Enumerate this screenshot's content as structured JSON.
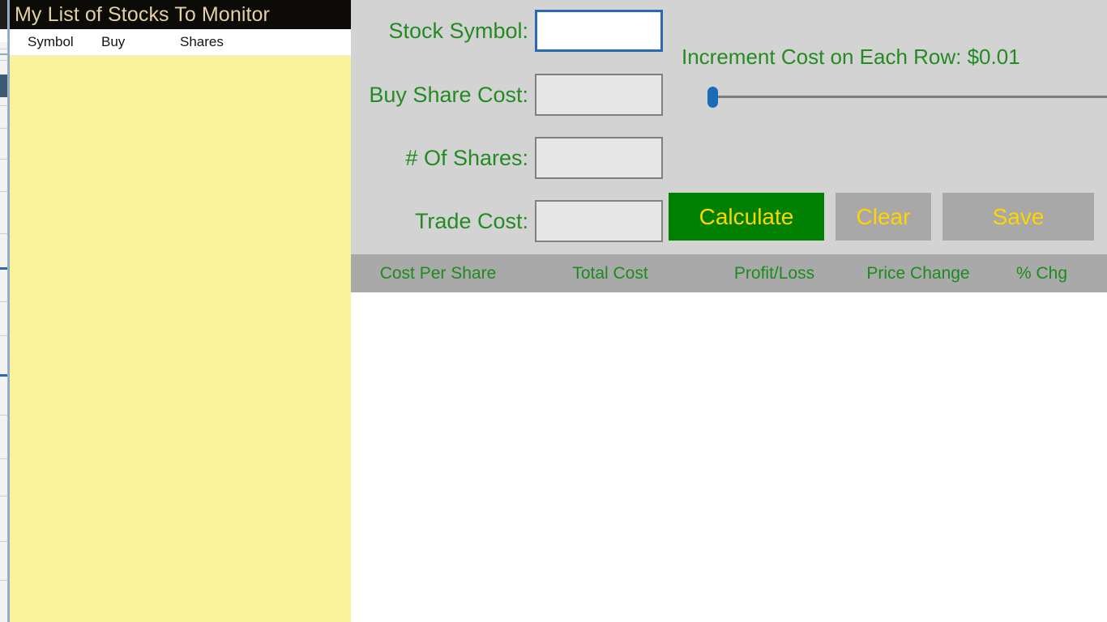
{
  "background_window": {
    "name": "partial-window-sliver"
  },
  "stock_list": {
    "title": "My List of Stocks To Monitor",
    "columns": [
      "Symbol",
      "Buy",
      "Shares"
    ],
    "rows": []
  },
  "form": {
    "fields": [
      {
        "label": "Stock Symbol:",
        "value": "",
        "placeholder": "",
        "focused": true,
        "enabled": true
      },
      {
        "label": "Buy Share Cost:",
        "value": "",
        "placeholder": "",
        "focused": false,
        "enabled": false
      },
      {
        "label": "# Of Shares:",
        "value": "",
        "placeholder": "",
        "focused": false,
        "enabled": false
      },
      {
        "label": "Trade Cost:",
        "value": "",
        "placeholder": "",
        "focused": false,
        "enabled": false
      }
    ],
    "increment": {
      "label": "Increment Cost on Each Row: $0.01",
      "value": "0.01",
      "slider_position_percent": 0
    },
    "buttons": [
      {
        "label": "Calculate",
        "state": "enabled"
      },
      {
        "label": "Clear",
        "state": "disabled"
      },
      {
        "label": "Save",
        "state": "disabled"
      }
    ]
  },
  "results": {
    "columns": [
      "Cost Per Share",
      "Total Cost",
      "Profit/Loss",
      "Price Change",
      "% Chg"
    ],
    "rows": []
  },
  "colors": {
    "label_green": "#238b22",
    "title_bar": "#0d0b07",
    "title_text": "#e2d1a4",
    "list_background": "#faf29a",
    "form_background": "#d3d3d3",
    "results_header_bg": "#a9a9a9",
    "calculate_green": "#008000",
    "button_text_gold": "#ffd400",
    "disabled_button_gray": "#a8a8a8",
    "focus_blue": "#2a6ab5",
    "slider_thumb_blue": "#1a6bb8"
  }
}
